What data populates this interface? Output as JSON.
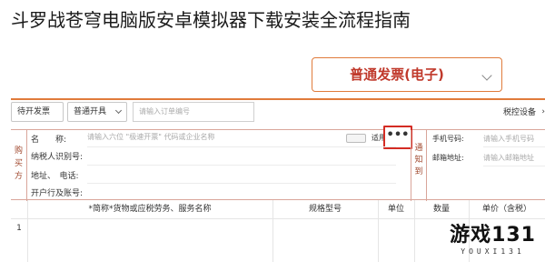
{
  "page_title": "斗罗战苍穹电脑版安卓模拟器下载安装全流程指南",
  "invoice_type": {
    "selected": "普通发票(电子)"
  },
  "toolbar": {
    "pending_label": "待开发票",
    "kind_label": "普通开具",
    "order_placeholder": "请输入订单编号",
    "tax_device_label": "税控设备"
  },
  "buyer": {
    "section_label": [
      "购",
      "买",
      "方"
    ],
    "name_label": "名　　称:",
    "name_placeholder": "请输入六位 \"极速开票\" 代码或企业名称",
    "toggle_label": "适用",
    "more_label": "•••",
    "tax_id_label": "纳税人识别号:",
    "address_label": "地址、　电话:",
    "bank_label": "开户行及账号:"
  },
  "notify": {
    "section_label": [
      "通",
      "知",
      "到"
    ],
    "phone_label": "手机号码:",
    "phone_placeholder": "请输入手机号码",
    "email_label": "邮箱地址:",
    "email_placeholder": "请输入邮箱地址"
  },
  "items": {
    "headers": {
      "name": "*简称*货物或应税劳务、服务名称",
      "spec": "规格型号",
      "unit": "单位",
      "qty": "数量",
      "price": "单价（含税）"
    },
    "rows": [
      {
        "no": "1"
      }
    ]
  },
  "watermark": {
    "main": "游戏131",
    "sub": "YOUXI131"
  },
  "colors": {
    "accent_orange": "#e07b3b",
    "highlight_red": "#d42c24",
    "label_brown": "#a0482e"
  }
}
